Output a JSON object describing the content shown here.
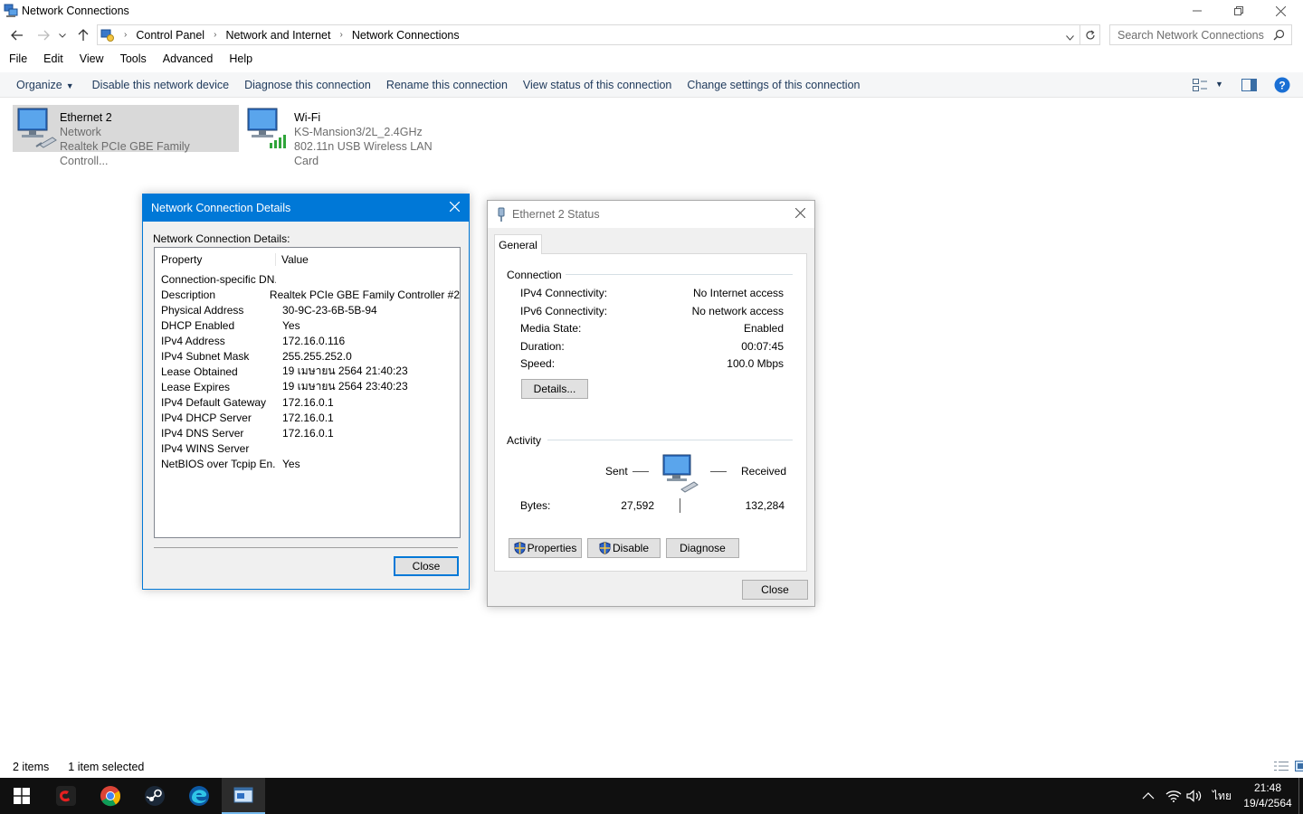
{
  "window": {
    "title": "Network Connections"
  },
  "address": {
    "crumbs": [
      "Control Panel",
      "Network and Internet",
      "Network Connections"
    ],
    "search_placeholder": "Search Network Connections"
  },
  "menu": [
    "File",
    "Edit",
    "View",
    "Tools",
    "Advanced",
    "Help"
  ],
  "commands": {
    "organize": "Organize",
    "items": [
      "Disable this network device",
      "Diagnose this connection",
      "Rename this connection",
      "View status of this connection",
      "Change settings of this connection"
    ]
  },
  "connections": [
    {
      "name": "Ethernet 2",
      "status": "Network",
      "device": "Realtek PCIe GBE Family Controll..."
    },
    {
      "name": "Wi-Fi",
      "status": "KS-Mansion3/2L_2.4GHz",
      "device": "802.11n USB Wireless LAN Card"
    }
  ],
  "statusbar": {
    "count": "2 items",
    "selected": "1 item selected"
  },
  "details_dialog": {
    "title": "Network Connection Details",
    "label": "Network Connection Details:",
    "col_property": "Property",
    "col_value": "Value",
    "rows": [
      {
        "property": "Connection-specific DN...",
        "value": ""
      },
      {
        "property": "Description",
        "value": "Realtek PCIe GBE Family Controller #2"
      },
      {
        "property": "Physical Address",
        "value": "30-9C-23-6B-5B-94"
      },
      {
        "property": "DHCP Enabled",
        "value": "Yes"
      },
      {
        "property": "IPv4 Address",
        "value": "172.16.0.116"
      },
      {
        "property": "IPv4 Subnet Mask",
        "value": "255.255.252.0"
      },
      {
        "property": "Lease Obtained",
        "value": "19 เมษายน 2564 21:40:23"
      },
      {
        "property": "Lease Expires",
        "value": "19 เมษายน 2564 23:40:23"
      },
      {
        "property": "IPv4 Default Gateway",
        "value": "172.16.0.1"
      },
      {
        "property": "IPv4 DHCP Server",
        "value": "172.16.0.1"
      },
      {
        "property": "IPv4 DNS Server",
        "value": "172.16.0.1"
      },
      {
        "property": "IPv4 WINS Server",
        "value": ""
      },
      {
        "property": "NetBIOS over Tcpip En...",
        "value": "Yes"
      }
    ],
    "close_label": "Close"
  },
  "status_dialog": {
    "title": "Ethernet 2 Status",
    "tab": "General",
    "connection_group": "Connection",
    "fields": [
      {
        "label": "IPv4 Connectivity:",
        "value": "No Internet access"
      },
      {
        "label": "IPv6 Connectivity:",
        "value": "No network access"
      },
      {
        "label": "Media State:",
        "value": "Enabled"
      },
      {
        "label": "Duration:",
        "value": "00:07:45"
      },
      {
        "label": "Speed:",
        "value": "100.0 Mbps"
      }
    ],
    "details_button": "Details...",
    "activity_group": "Activity",
    "sent_label": "Sent",
    "received_label": "Received",
    "bytes_label": "Bytes:",
    "bytes_sent": "27,592",
    "bytes_received": "132,284",
    "properties_button": "Properties",
    "disable_button": "Disable",
    "diagnose_button": "Diagnose",
    "close_button": "Close"
  },
  "taskbar": {
    "language": "ไทย",
    "time": "21:48",
    "date": "19/4/2564"
  },
  "colors": {
    "accent": "#0078d7",
    "selected_item": "#d9d9d9",
    "taskbar": "#101010"
  }
}
